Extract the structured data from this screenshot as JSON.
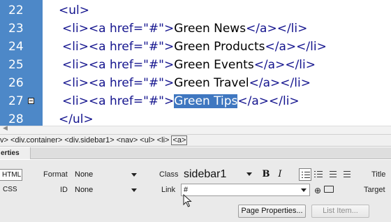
{
  "editor": {
    "lines": [
      {
        "num": "22",
        "indent": "    ",
        "parts": [
          {
            "t": "<ul>",
            "c": "tag"
          }
        ]
      },
      {
        "num": "23",
        "indent": "      ",
        "parts": [
          {
            "t": "<li>",
            "c": "tag"
          },
          {
            "t": "<a href=",
            "c": "tag"
          },
          {
            "t": "\"#\"",
            "c": "val"
          },
          {
            "t": ">",
            "c": "tag"
          },
          {
            "t": "Green News",
            "c": "txt"
          },
          {
            "t": "</a></li>",
            "c": "tag"
          }
        ]
      },
      {
        "num": "24",
        "indent": "      ",
        "parts": [
          {
            "t": "<li>",
            "c": "tag"
          },
          {
            "t": "<a href=",
            "c": "tag"
          },
          {
            "t": "\"#\"",
            "c": "val"
          },
          {
            "t": ">",
            "c": "tag"
          },
          {
            "t": "Green Products",
            "c": "txt"
          },
          {
            "t": "</a></li>",
            "c": "tag"
          }
        ]
      },
      {
        "num": "25",
        "indent": "      ",
        "parts": [
          {
            "t": "<li>",
            "c": "tag"
          },
          {
            "t": "<a href=",
            "c": "tag"
          },
          {
            "t": "\"#\"",
            "c": "val"
          },
          {
            "t": ">",
            "c": "tag"
          },
          {
            "t": "Green Events",
            "c": "txt"
          },
          {
            "t": "</a></li>",
            "c": "tag"
          }
        ]
      },
      {
        "num": "26",
        "indent": "      ",
        "parts": [
          {
            "t": "<li>",
            "c": "tag"
          },
          {
            "t": "<a href=",
            "c": "tag"
          },
          {
            "t": "\"#\"",
            "c": "val"
          },
          {
            "t": ">",
            "c": "tag"
          },
          {
            "t": "Green Travel",
            "c": "txt"
          },
          {
            "t": "</a></li>",
            "c": "tag"
          }
        ]
      },
      {
        "num": "27",
        "indent": "      ",
        "fold": true,
        "parts": [
          {
            "t": "<li>",
            "c": "tag"
          },
          {
            "t": "<a href=",
            "c": "tag"
          },
          {
            "t": "\"#\"",
            "c": "val"
          },
          {
            "t": ">",
            "c": "tag"
          },
          {
            "t": "Green Tips",
            "c": "sel"
          },
          {
            "t": "</a></li>",
            "c": "tag"
          }
        ]
      },
      {
        "num": "28",
        "indent": "    ",
        "parts": [
          {
            "t": "</ul>",
            "c": "tag"
          }
        ]
      }
    ],
    "colors": {
      "gutter": "#4d88c8",
      "tag": "#14148e",
      "selection": "#3f77c0"
    }
  },
  "tag_selector": {
    "crumbs": [
      "v>",
      "<div.container>",
      "<div.sidebar1>",
      "<nav>",
      "<ul>",
      "<li>",
      "<a>"
    ],
    "current_index": 6
  },
  "properties": {
    "tab_label": "erties",
    "html_button": "HTML",
    "css_button": "CSS",
    "format_label": "Format",
    "format_value": "None",
    "id_label": "ID",
    "id_value": "None",
    "class_label": "Class",
    "class_value": "sidebar1",
    "link_label": "Link",
    "link_value": "#",
    "bold_label": "B",
    "italic_label": "I",
    "title_label": "Title",
    "target_label": "Target",
    "page_properties_button": "Page Properties...",
    "list_item_button": "List Item..."
  }
}
